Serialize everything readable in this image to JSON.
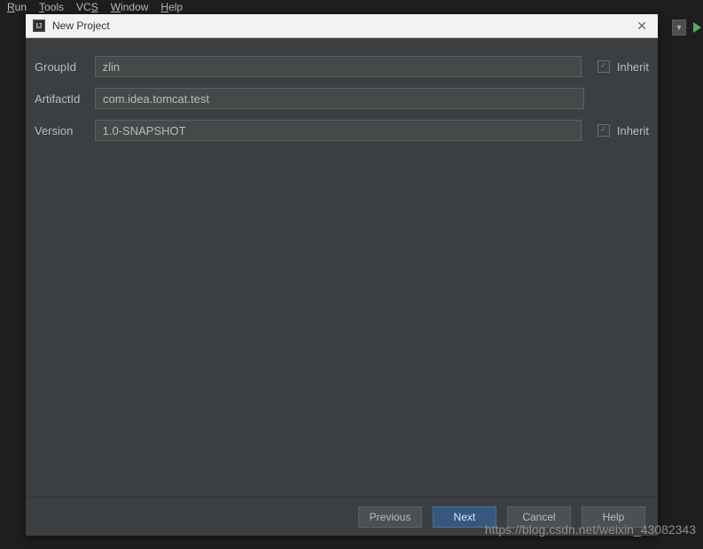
{
  "menubar": {
    "run": "Run",
    "tools": "Tools",
    "vcs": "VCS",
    "window": "Window",
    "help": "Help"
  },
  "dialog": {
    "title": "New Project",
    "icon_text": "IJ",
    "fields": {
      "groupId": {
        "label": "GroupId",
        "value": "zlin",
        "inherit_label": "Inherit",
        "inherit_checked": true
      },
      "artifactId": {
        "label": "ArtifactId",
        "value": "com.idea.tomcat.test"
      },
      "version": {
        "label": "Version",
        "value": "1.0-SNAPSHOT",
        "inherit_label": "Inherit",
        "inherit_checked": true
      }
    },
    "buttons": {
      "previous": "Previous",
      "next": "Next",
      "cancel": "Cancel",
      "help": "Help"
    }
  },
  "watermark": "https://blog.csdn.net/weixin_43082343"
}
